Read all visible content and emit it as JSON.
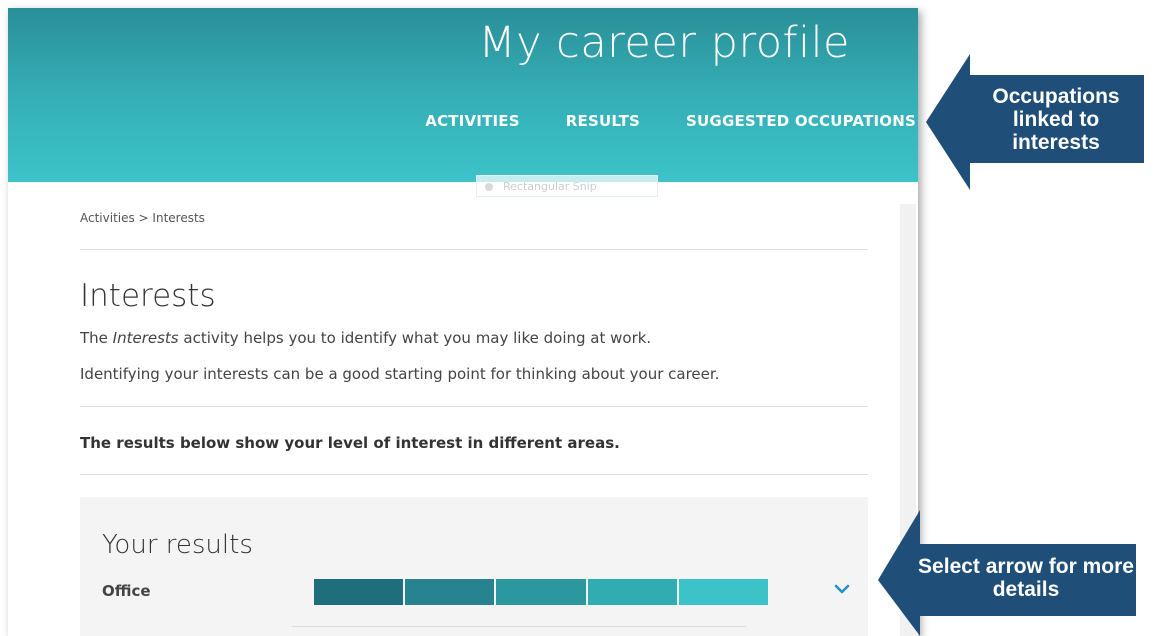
{
  "header": {
    "site_title": "My career profile",
    "nav": [
      {
        "label": "ACTIVITIES"
      },
      {
        "label": "RESULTS"
      },
      {
        "label": "SUGGESTED OCCUPATIONS"
      }
    ]
  },
  "snip_overlay": {
    "label": "Rectangular Snip"
  },
  "breadcrumb": "Activities > Interests",
  "page": {
    "title": "Interests",
    "intro_prefix": "The ",
    "intro_emphasis": "Interests",
    "intro_suffix": " activity helps you to identify what you may like doing at work.",
    "intro2": "Identifying your interests can be a good starting point for thinking about your career.",
    "lead": "The results below show your level of interest in different areas."
  },
  "results": {
    "title": "Your results",
    "rows": [
      {
        "label": "Office",
        "level": 5,
        "max": 5
      }
    ],
    "bar_colors": [
      "#1f6e7e",
      "#26838f",
      "#2b979f",
      "#31acb2",
      "#3bc3c8"
    ]
  },
  "callouts": {
    "occupations": "Occupations linked to interests",
    "select_arrow": "Select arrow for more details",
    "color": "#1f4e79"
  }
}
